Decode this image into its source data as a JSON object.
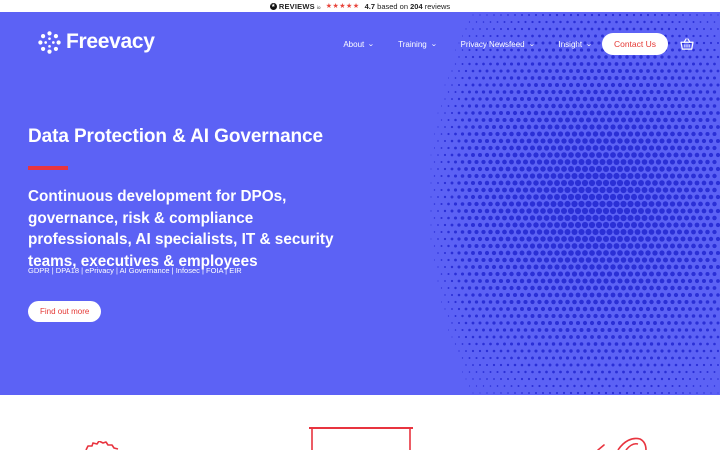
{
  "reviews": {
    "brand": "REVIEWS",
    "brand_suffix": "io",
    "stars": "★★★★★",
    "rating": "4.7",
    "based_on": "based on",
    "count": "204",
    "reviews_word": "reviews"
  },
  "header": {
    "logo_text": "Freevacy",
    "nav": [
      {
        "label": "About"
      },
      {
        "label": "Training"
      },
      {
        "label": "Privacy Newsfeed"
      },
      {
        "label": "Insight"
      }
    ],
    "contact_label": "Contact Us",
    "basket_icon": "basket-icon"
  },
  "hero": {
    "eyebrow": "Data Protection & AI Governance",
    "headline": "Continuous development for DPOs, governance, risk & compliance professionals, AI specialists, IT & security teams, executives & employees",
    "topics": "GDPR | DPA18 | ePrivacy | AI Governance | Infosec | FOIA | EIR",
    "cta_label": "Find out more"
  },
  "colors": {
    "hero_bg": "#5c62f5",
    "dot_color": "#2a2fd6",
    "accent_red": "#e8343f"
  }
}
